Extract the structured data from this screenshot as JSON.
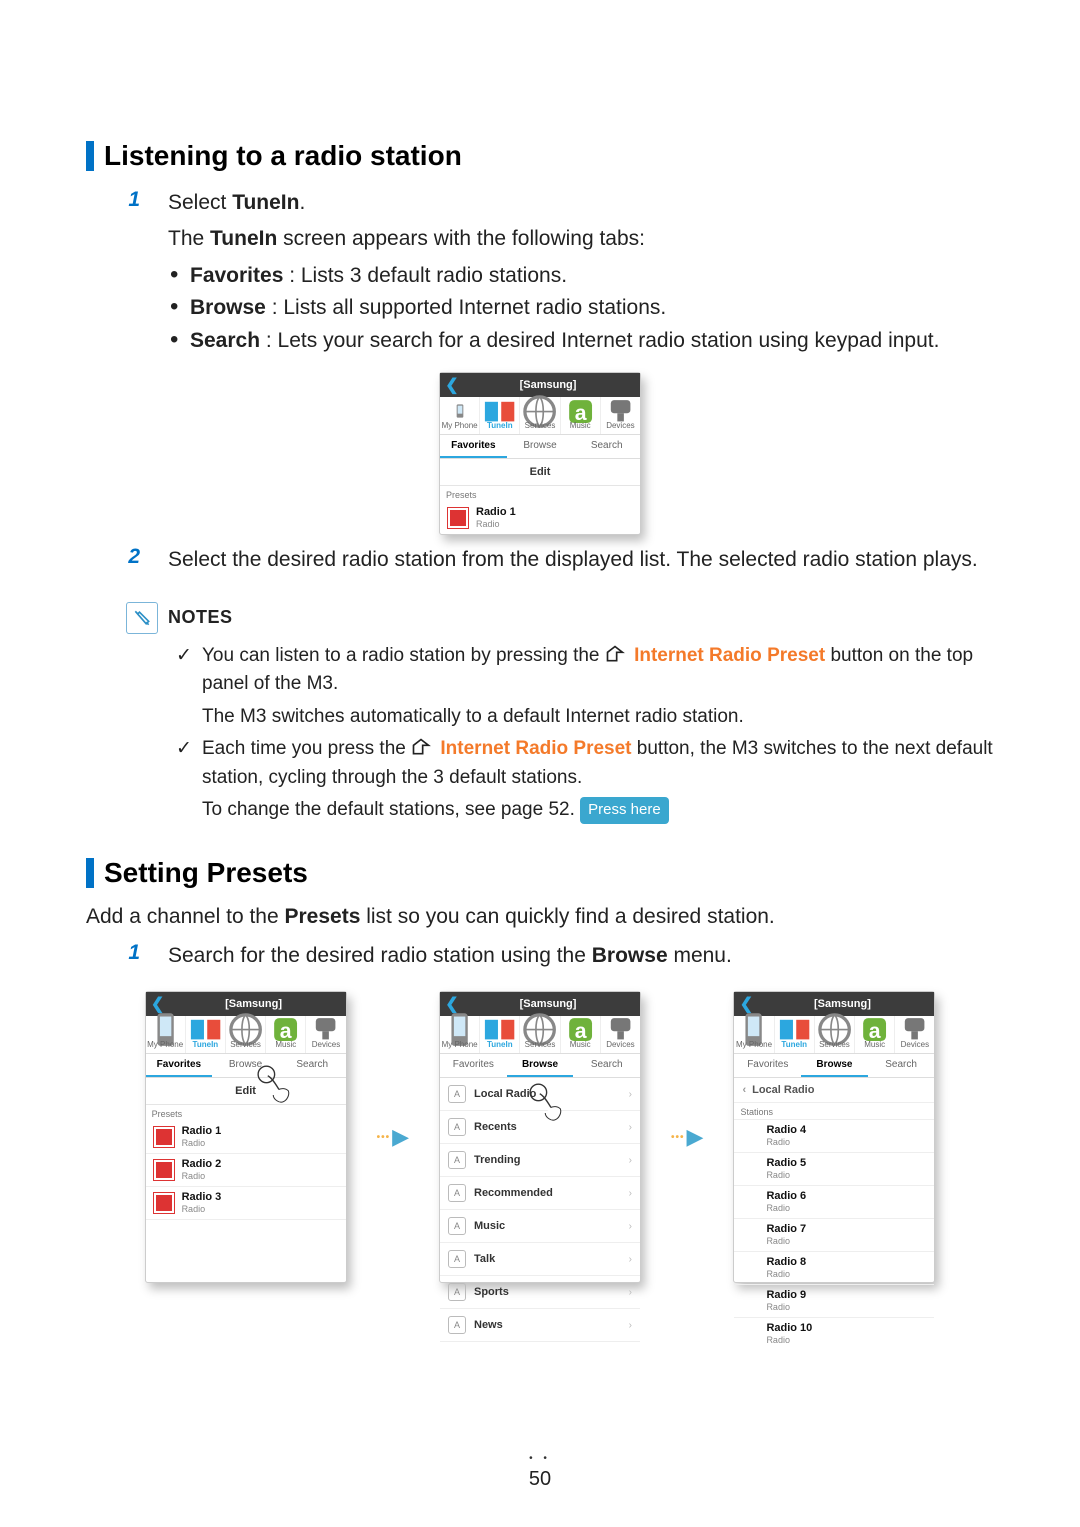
{
  "section1": {
    "title": "Listening to a radio station",
    "step1_lead": "Select ",
    "step1_bold": "TuneIn",
    "step1_sub": "The ",
    "step1_sub_bold": "TuneIn",
    "step1_sub_rest": " screen appears with the following tabs:",
    "bullets": [
      {
        "bold": "Favorites",
        "text": " : Lists 3 default radio stations."
      },
      {
        "bold": "Browse",
        "text": " : Lists all supported Internet radio stations."
      },
      {
        "bold": "Search",
        "text": " : Lets your search for a desired Internet radio station using keypad input."
      }
    ],
    "step2": "Select the desired radio station from the displayed list. The selected radio station plays."
  },
  "notes": {
    "heading": "NOTES",
    "items": [
      {
        "p1a": "You can listen to a radio station by pressing the ",
        "accent": "Internet Radio Preset",
        "p1b": " button on the top panel of the M3.",
        "p2": "The M3 switches automatically to a default Internet radio station."
      },
      {
        "p1a": "Each time you press the ",
        "accent": "Internet Radio Preset",
        "p1b": " button, the M3 switches to the next default station, cycling through the 3 default stations.",
        "p2a": "To change the default stations, see page 52. ",
        "chip": "Press here"
      }
    ]
  },
  "section2": {
    "title": "Setting Presets",
    "intro_a": "Add a channel to the ",
    "intro_bold": "Presets",
    "intro_b": " list so you can quickly find a desired station.",
    "step1_a": "Search for the desired radio station using the ",
    "step1_bold": "Browse",
    "step1_b": " menu."
  },
  "phone": {
    "title": "[Samsung]",
    "maintabs": [
      "My Phone",
      "TuneIn",
      "Services",
      "Music",
      "Devices"
    ],
    "subtabs": [
      "Favorites",
      "Browse",
      "Search"
    ],
    "edit": "Edit",
    "presets_label": "Presets",
    "stations_label": "Stations",
    "top_presets": {
      "title": "Radio 1",
      "sub": "Radio"
    },
    "presets3": [
      {
        "title": "Radio 1",
        "sub": "Radio"
      },
      {
        "title": "Radio 2",
        "sub": "Radio"
      },
      {
        "title": "Radio 3",
        "sub": "Radio"
      }
    ],
    "browse_rows": [
      "Local Radio",
      "Recents",
      "Trending",
      "Recommended",
      "Music",
      "Talk",
      "Sports",
      "News"
    ],
    "local_back": "Local Radio",
    "local_list": [
      {
        "title": "Radio 4",
        "sub": "Radio"
      },
      {
        "title": "Radio 5",
        "sub": "Radio"
      },
      {
        "title": "Radio 6",
        "sub": "Radio"
      },
      {
        "title": "Radio 7",
        "sub": "Radio"
      },
      {
        "title": "Radio 8",
        "sub": "Radio"
      },
      {
        "title": "Radio 9",
        "sub": "Radio"
      },
      {
        "title": "Radio 10",
        "sub": "Radio"
      }
    ]
  },
  "steps": {
    "one": "1",
    "two": "2"
  },
  "page_number": "50"
}
